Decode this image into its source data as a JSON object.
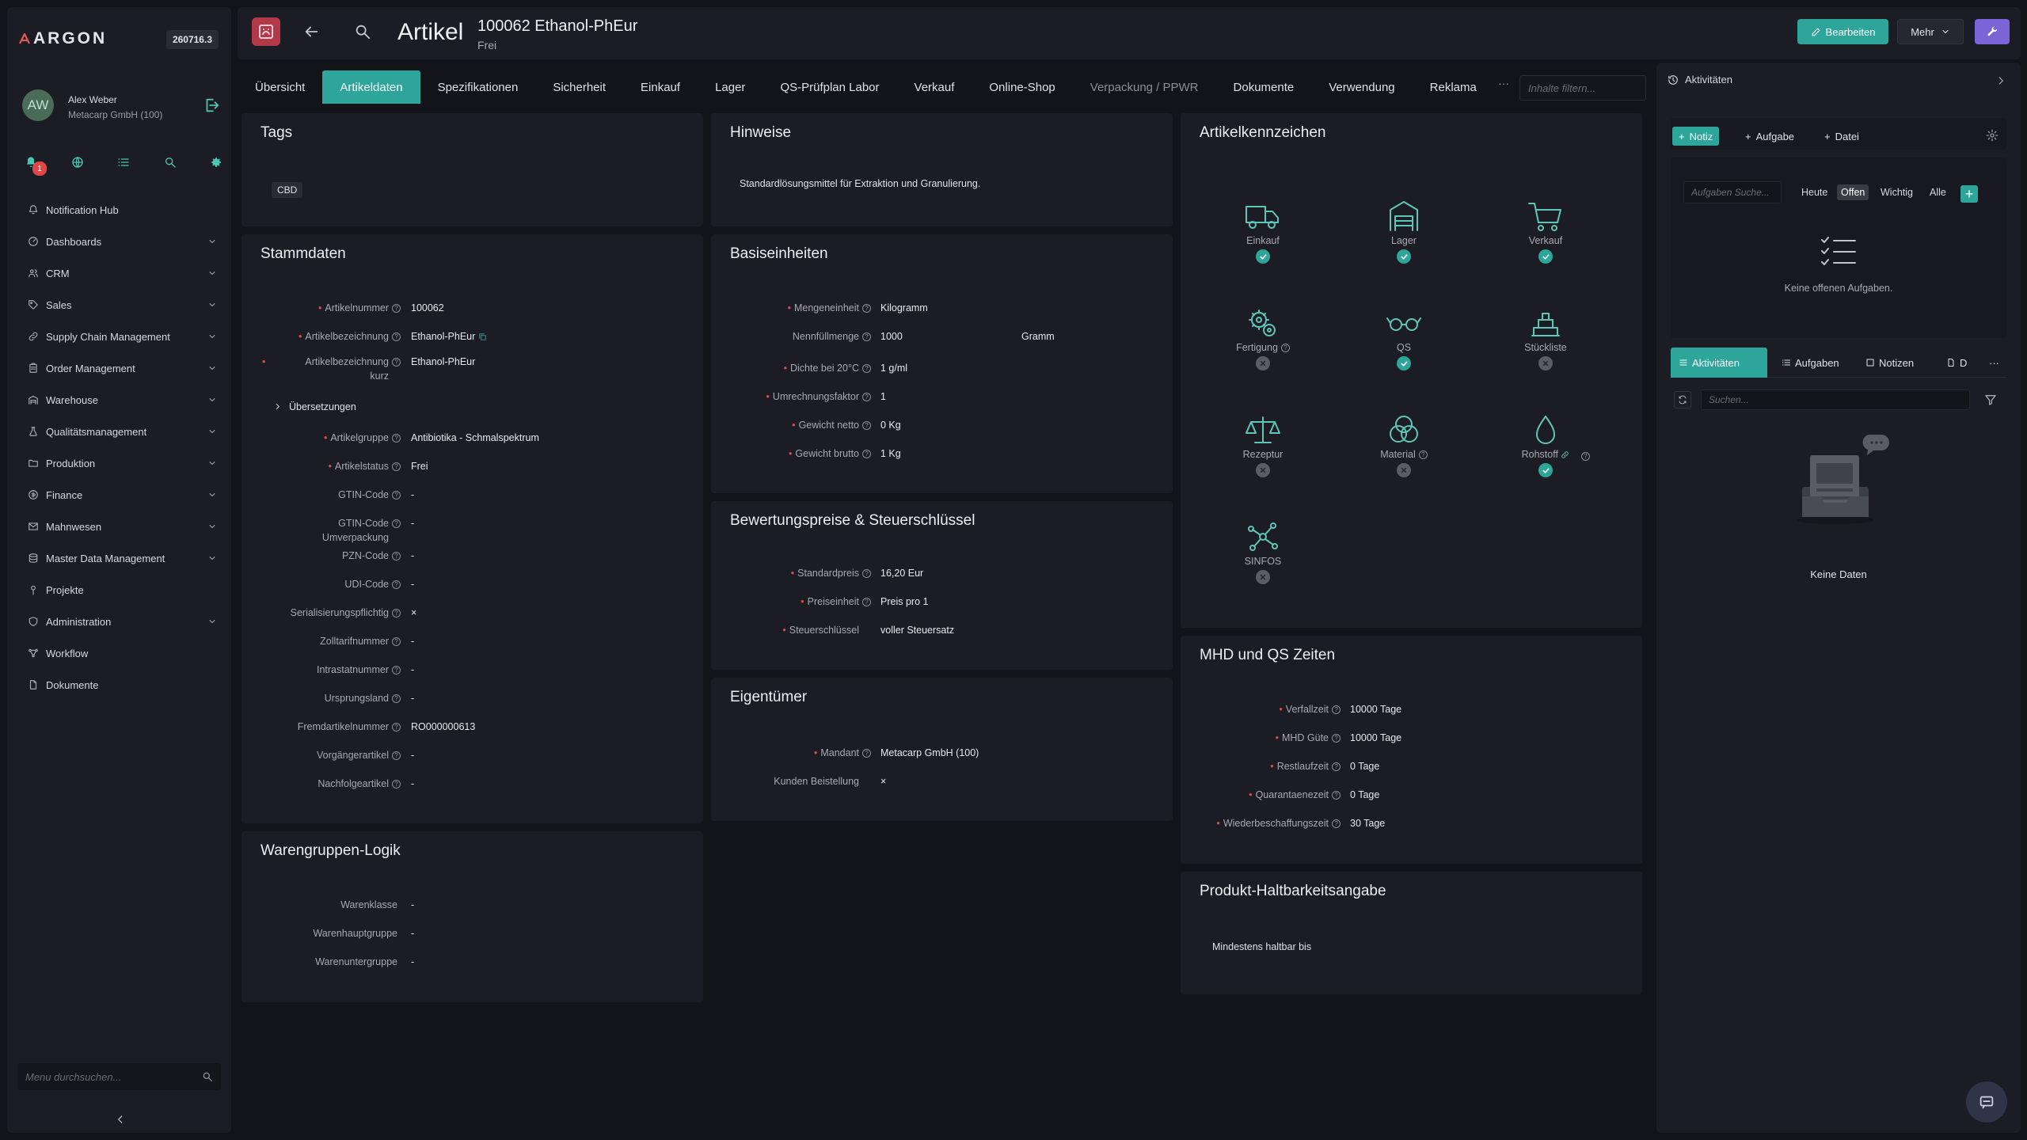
{
  "brand": {
    "logo": "ARGON",
    "version": "260716.3"
  },
  "user": {
    "initials": "AW",
    "name": "Alex Weber",
    "company": "Metacarp GmbH (100)",
    "notifications": "1"
  },
  "sidebar": {
    "items": [
      {
        "label": "Notification Hub"
      },
      {
        "label": "Dashboards"
      },
      {
        "label": "CRM"
      },
      {
        "label": "Sales"
      },
      {
        "label": "Supply Chain Management"
      },
      {
        "label": "Order Management"
      },
      {
        "label": "Warehouse"
      },
      {
        "label": "Qualitätsmanagement"
      },
      {
        "label": "Produktion"
      },
      {
        "label": "Finance"
      },
      {
        "label": "Mahnwesen"
      },
      {
        "label": "Master Data Management"
      },
      {
        "label": "Projekte"
      },
      {
        "label": "Administration"
      },
      {
        "label": "Workflow"
      },
      {
        "label": "Dokumente"
      }
    ],
    "search_placeholder": "Menu durchsuchen..."
  },
  "header": {
    "page_title": "Artikel",
    "article_title": "100062 Ethanol-PhEur",
    "article_status": "Frei",
    "edit_label": "Bearbeiten",
    "more_label": "Mehr"
  },
  "tabs": [
    {
      "label": "Übersicht"
    },
    {
      "label": "Artikeldaten"
    },
    {
      "label": "Spezifikationen"
    },
    {
      "label": "Sicherheit"
    },
    {
      "label": "Einkauf"
    },
    {
      "label": "Lager"
    },
    {
      "label": "QS-Prüfplan Labor"
    },
    {
      "label": "Verkauf"
    },
    {
      "label": "Online-Shop"
    },
    {
      "label": "Verpackung / PPWR"
    },
    {
      "label": "Dokumente"
    },
    {
      "label": "Verwendung"
    },
    {
      "label": "Reklama"
    }
  ],
  "tabs_more": "···",
  "content_filter_placeholder": "Inhalte filtern...",
  "tags": {
    "title": "Tags",
    "items": [
      "CBD"
    ]
  },
  "hinweise": {
    "title": "Hinweise",
    "text": "Standardlösungsmittel für Extraktion und Granulierung."
  },
  "stammdaten": {
    "title": "Stammdaten",
    "translations_label": "Übersetzungen",
    "fields": [
      {
        "label": "Artikelnummer",
        "value": "100062"
      },
      {
        "label": "Artikelbezeichnung",
        "value": "Ethanol-PhEur"
      },
      {
        "label": "Artikelbezeichnung",
        "label2": "kurz",
        "value": "Ethanol-PhEur"
      },
      {
        "label": "Artikelgruppe",
        "value": "Antibiotika - Schmalspektrum"
      },
      {
        "label": "Artikelstatus",
        "value": "Frei"
      },
      {
        "label": "GTIN-Code",
        "value": "-"
      },
      {
        "label": "GTIN-Code",
        "label2": "Umverpackung",
        "value": "-"
      },
      {
        "label": "PZN-Code",
        "value": "-"
      },
      {
        "label": "UDI-Code",
        "value": "-"
      },
      {
        "label": "Serialisierungspflichtig",
        "value": "×"
      },
      {
        "label": "Zolltarifnummer",
        "value": "-"
      },
      {
        "label": "Intrastatnummer",
        "value": "-"
      },
      {
        "label": "Ursprungsland",
        "value": "-"
      },
      {
        "label": "Fremdartikelnummer",
        "value": "RO000000613"
      },
      {
        "label": "Vorgängerartikel",
        "value": "-"
      },
      {
        "label": "Nachfolgeartikel",
        "value": "-"
      }
    ]
  },
  "warengruppen": {
    "title": "Warengruppen-Logik",
    "fields": [
      {
        "label": "Warenklasse",
        "value": "-"
      },
      {
        "label": "Warenhauptgruppe",
        "value": "-"
      },
      {
        "label": "Warenuntergruppe",
        "value": "-"
      }
    ]
  },
  "basiseinheiten": {
    "title": "Basiseinheiten",
    "fields": [
      {
        "label": "Mengeneinheit",
        "value": "Kilogramm"
      },
      {
        "label": "Nennfüllmenge",
        "value": "1000",
        "extra": "Gramm"
      },
      {
        "label": "Dichte bei 20°C",
        "value": "1 g/ml"
      },
      {
        "label": "Umrechnungsfaktor",
        "value": "1"
      },
      {
        "label": "Gewicht netto",
        "value": "0 Kg"
      },
      {
        "label": "Gewicht brutto",
        "value": "1 Kg"
      }
    ]
  },
  "bewertung": {
    "title": "Bewertungspreise & Steuerschlüssel",
    "fields": [
      {
        "label": "Standardpreis",
        "value": "16,20 Eur"
      },
      {
        "label": "Preiseinheit",
        "value": "Preis pro 1"
      },
      {
        "label": "Steuerschlüssel",
        "value": "voller Steuersatz"
      }
    ]
  },
  "eigentuemer": {
    "title": "Eigentümer",
    "fields": [
      {
        "label": "Mandant",
        "value": "Metacarp GmbH (100)"
      },
      {
        "label": "Kunden Beistellung",
        "value": "×"
      }
    ]
  },
  "kennzeichen": {
    "title": "Artikelkennzeichen",
    "items": [
      {
        "label": "Einkauf",
        "icon": "truck-icon",
        "status": "yes"
      },
      {
        "label": "Lager",
        "icon": "warehouse-icon",
        "status": "yes"
      },
      {
        "label": "Verkauf",
        "icon": "cart-icon",
        "status": "yes"
      },
      {
        "label": "Fertigung",
        "icon": "gears-icon",
        "status": "no"
      },
      {
        "label": "QS",
        "icon": "glasses-icon",
        "status": "yes"
      },
      {
        "label": "Stückliste",
        "icon": "stack-icon",
        "status": "no"
      },
      {
        "label": "Rezeptur",
        "icon": "scale-icon",
        "status": "no"
      },
      {
        "label": "Material",
        "icon": "circles-icon",
        "status": "no"
      },
      {
        "label": "Rohstoff",
        "icon": "drop-icon",
        "status": "yes"
      },
      {
        "label": "SINFOS",
        "icon": "network-icon",
        "status": "no"
      }
    ]
  },
  "mhd": {
    "title": "MHD und QS Zeiten",
    "fields": [
      {
        "label": "Verfallzeit",
        "value": "10000 Tage"
      },
      {
        "label": "MHD Güte",
        "value": "10000 Tage"
      },
      {
        "label": "Restlaufzeit",
        "value": "0 Tage"
      },
      {
        "label": "Quarantaenezeit",
        "value": "0 Tage"
      },
      {
        "label": "Wiederbeschaffungszeit",
        "value": "30 Tage"
      }
    ]
  },
  "haltbarkeit": {
    "title": "Produkt-Haltbarkeitsangabe",
    "text": "Mindestens haltbar bis"
  },
  "right_panel": {
    "title": "Aktivitäten",
    "actions": {
      "note": "Notiz",
      "task": "Aufgabe",
      "file": "Datei"
    },
    "task_search_placeholder": "Aufgaben Suche...",
    "filters": [
      "Heute",
      "Offen",
      "Wichtig",
      "Alle"
    ],
    "empty_tasks": "Keine offenen Aufgaben.",
    "tabs": [
      "Aktivitäten",
      "Aufgaben",
      "Notizen",
      "D"
    ],
    "tabs_more": "···",
    "search_placeholder": "Suchen...",
    "empty": "Keine Daten"
  },
  "colors": {
    "accent": "#2da59a",
    "purple": "#7b63d8",
    "required": "#d84c4c"
  }
}
